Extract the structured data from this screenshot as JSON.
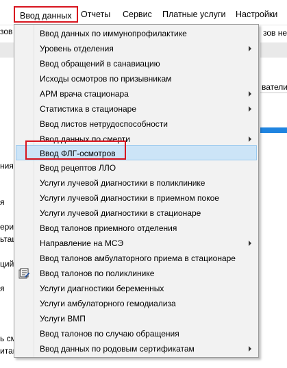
{
  "menubar": {
    "items": [
      {
        "label": "Ввод данных",
        "open": true
      },
      {
        "label": "Отчеты"
      },
      {
        "label": "Сервис"
      },
      {
        "label": "Платные услуги"
      },
      {
        "label": "Настройки"
      }
    ]
  },
  "background": {
    "left_texts": [
      "зов",
      "ния",
      "я",
      "ериз",
      "ьтац",
      "ций",
      "я",
      "ь сме",
      "итац"
    ],
    "right_texts": [
      "зов не",
      "ватели с"
    ]
  },
  "dropdown": {
    "items": [
      {
        "label": "Ввод данных по иммунопрофилактике",
        "submenu": false
      },
      {
        "label": "Уровень отделения",
        "submenu": true
      },
      {
        "label": "Ввод обращений в санавиацию",
        "submenu": false
      },
      {
        "label": "Исходы осмотров по призывникам",
        "submenu": false
      },
      {
        "label": "АРМ врача стационара",
        "submenu": true
      },
      {
        "label": "Статистика в стационаре",
        "submenu": true
      },
      {
        "label": "Ввод листов нетрудоспособности",
        "submenu": false
      },
      {
        "label": "Ввод данных по смерти",
        "submenu": true
      },
      {
        "label": "Ввод ФЛГ-осмотров",
        "submenu": false,
        "highlighted": true
      },
      {
        "label": "Ввод рецептов ЛЛО",
        "submenu": false
      },
      {
        "label": "Услуги лучевой диагностики в поликлинике",
        "submenu": false
      },
      {
        "label": "Услуги лучевой диагностики в приемном покое",
        "submenu": false
      },
      {
        "label": "Услуги лучевой диагностики в стационаре",
        "submenu": false
      },
      {
        "label": "Ввод талонов приемного отделения",
        "submenu": false
      },
      {
        "label": "Направление на МСЭ",
        "submenu": true
      },
      {
        "label": "Ввод талонов амбулаторного приема в стационаре",
        "submenu": false
      },
      {
        "label": "Ввод талонов по поликлинике",
        "submenu": false,
        "icon": "form-edit-icon"
      },
      {
        "label": "Услуги диагностики беременных",
        "submenu": false
      },
      {
        "label": "Услуги амбулаторного гемодиализа",
        "submenu": false
      },
      {
        "label": "Услуги ВМП",
        "submenu": false
      },
      {
        "label": "Ввод талонов по случаю обращения",
        "submenu": false
      },
      {
        "label": "Ввод данных по родовым сертификатам",
        "submenu": true
      }
    ]
  },
  "colors": {
    "highlight_box": "#d8141e",
    "hover_bg": "#cce4f7",
    "hover_border": "#99c9ef",
    "selection_blue": "#1f84e0"
  }
}
